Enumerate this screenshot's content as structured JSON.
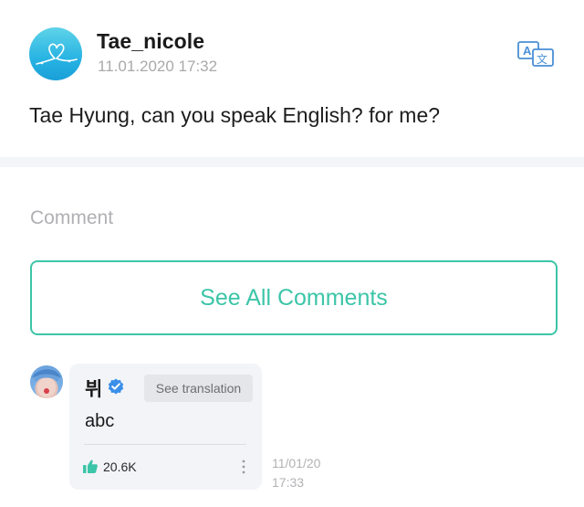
{
  "post": {
    "username": "Tae_nicole",
    "timestamp": "11.01.2020 17:32",
    "text": "Tae Hyung, can you speak English? for me?",
    "avatar_icon": "heart-doodle-icon",
    "translate_icon": "translate-icon"
  },
  "comments_section": {
    "heading": "Comment",
    "see_all_label": "See All Comments"
  },
  "comment": {
    "author": "뷔",
    "verified_icon": "verified-badge-icon",
    "see_translation_label": "See translation",
    "text": "abc",
    "like_icon": "thumbs-up-icon",
    "like_count": "20.6K",
    "date": "11/01/20",
    "time": "17:33"
  },
  "colors": {
    "accent": "#3cc5a8",
    "verified": "#3a8fe8",
    "translate": "#4a8fd6"
  }
}
